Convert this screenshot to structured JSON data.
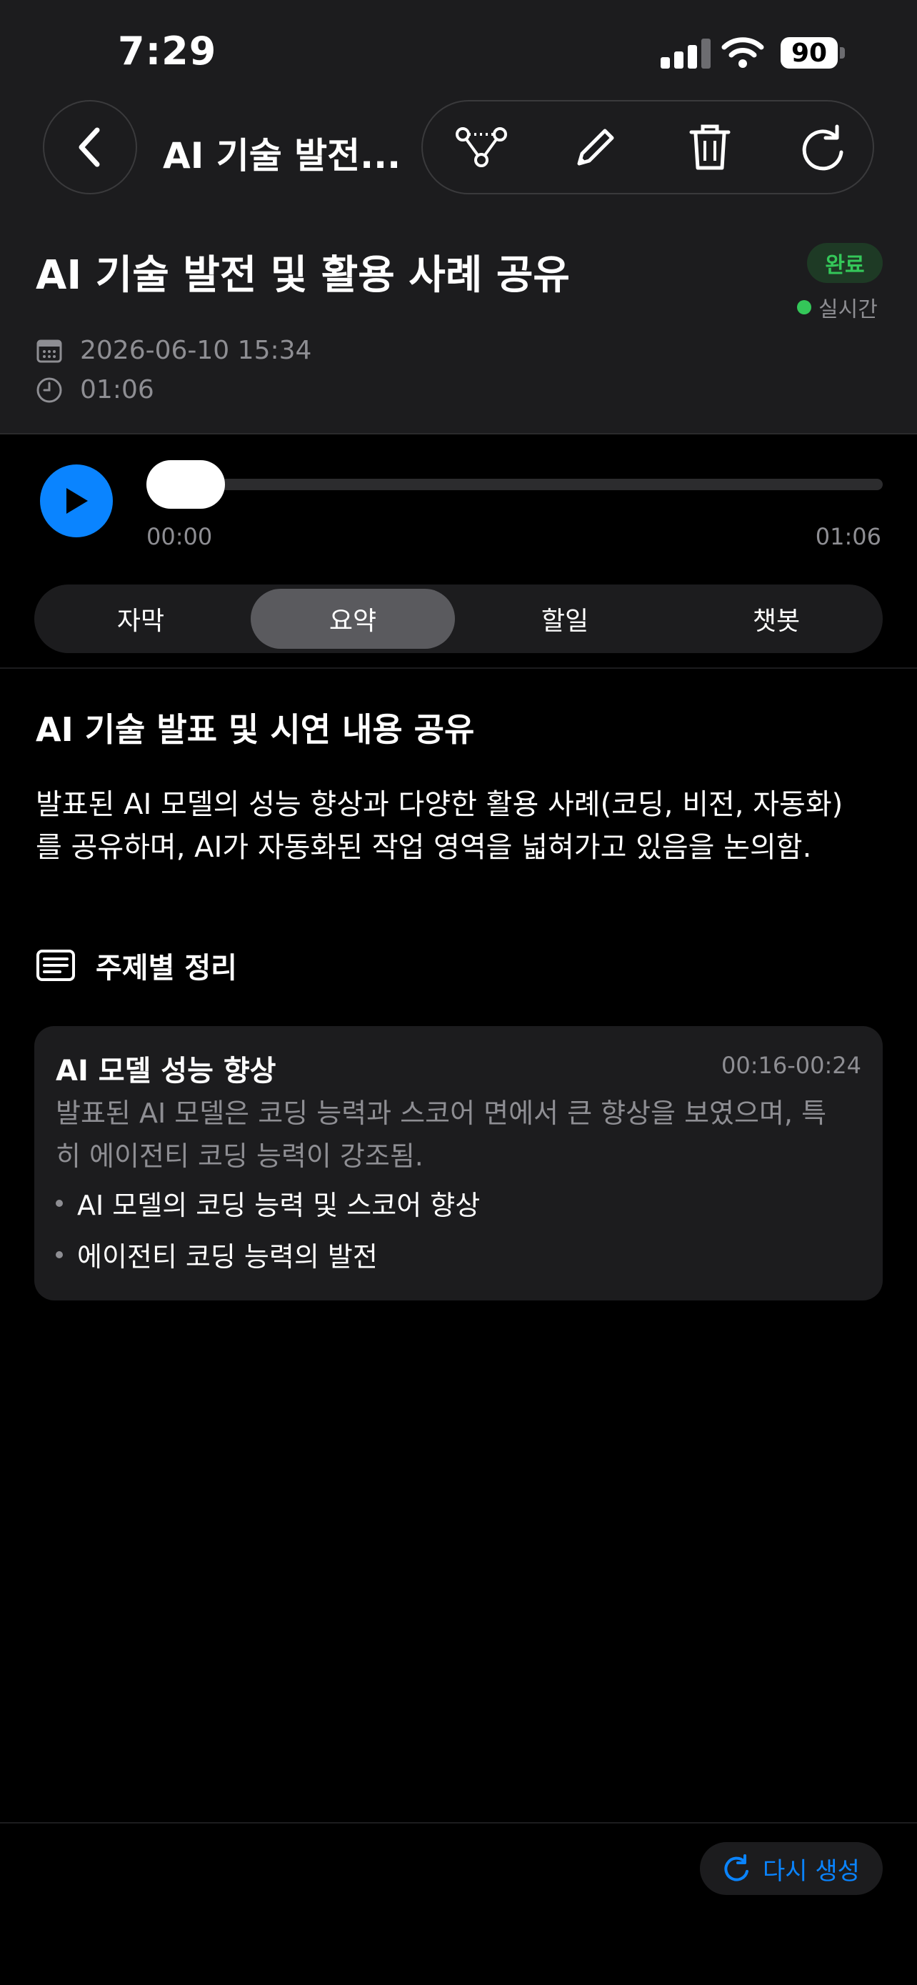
{
  "status_bar": {
    "time": "7:29",
    "battery": "90"
  },
  "nav": {
    "back_icon": "chevron-left-icon",
    "title": "AI 기술 발전..."
  },
  "actions": [
    {
      "name": "share-graph-icon"
    },
    {
      "name": "pencil-icon"
    },
    {
      "name": "trash-icon"
    },
    {
      "name": "refresh-icon"
    }
  ],
  "header": {
    "title": "AI 기술 발전 및 활용 사례 공유",
    "status_badge": "완료",
    "live_label": "실시간",
    "date": "2026-06-10 15:34",
    "duration": "01:06"
  },
  "player": {
    "current_time": "00:00",
    "total_time": "01:06",
    "progress": 0
  },
  "tabs": [
    {
      "label": "자막",
      "active": false
    },
    {
      "label": "요약",
      "active": true
    },
    {
      "label": "할일",
      "active": false
    },
    {
      "label": "챗봇",
      "active": false
    }
  ],
  "summary": {
    "heading": "AI 기술 발표 및 시연 내용 공유",
    "text": "발표된 AI 모델의 성능 향상과 다양한 활용 사례(코딩, 비전, 자동화)를 공유하며, AI가 자동화된 작업 영역을 넓혀가고 있음을 논의함.",
    "section_title": "주제별 정리"
  },
  "topics": [
    {
      "title": "AI 모델 성능 향상",
      "time_range": "00:16-00:24",
      "description": "발표된 AI 모델은 코딩 능력과 스코어 면에서 큰 향상을 보였으며, 특히 에이전티 코딩 능력이 강조됨.",
      "bullets": [
        "AI 모델의 코딩 능력 및 스코어 향상",
        "에이전티 코딩 능력의 발전"
      ]
    }
  ],
  "footer": {
    "regenerate_label": "다시 생성"
  },
  "colors": {
    "accent": "#0a84ff",
    "success": "#34c759",
    "background": "#000000",
    "surface": "#1c1c1e"
  }
}
